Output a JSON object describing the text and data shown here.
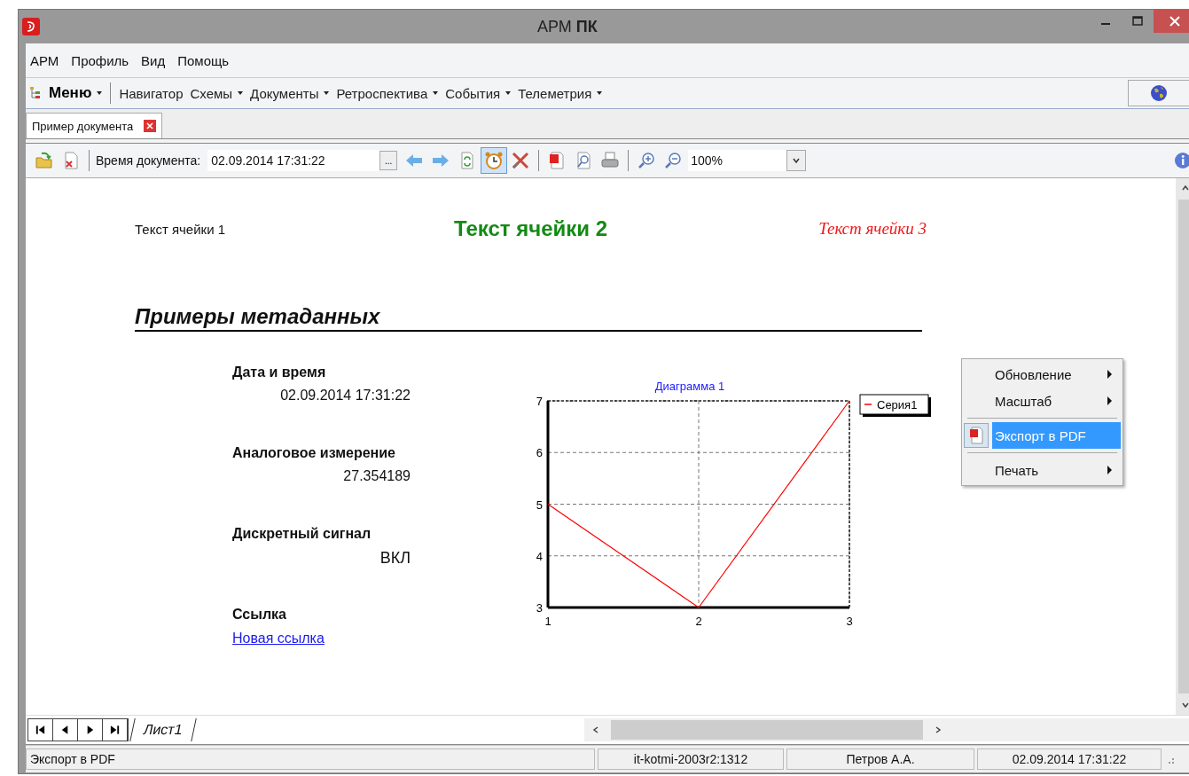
{
  "window": {
    "title": "АРМ **ПК**"
  },
  "menu_bar": [
    "АРМ",
    "Профиль",
    "Вид",
    "Помощь"
  ],
  "main_toolbar": {
    "menu_button": "Меню",
    "items": [
      {
        "label": "Навигатор",
        "has_dropdown": false
      },
      {
        "label": "Схемы",
        "has_dropdown": true
      },
      {
        "label": "Документы",
        "has_dropdown": true
      },
      {
        "label": "Ретроспектива",
        "has_dropdown": true
      },
      {
        "label": "События",
        "has_dropdown": true
      },
      {
        "label": "Телеметрия",
        "has_dropdown": true
      }
    ]
  },
  "tabs": [
    {
      "label": "Пример документа",
      "selected": true
    }
  ],
  "document_toolbar": {
    "time_label": "Время документа:",
    "time_value": "02.09.2014 17:31:22",
    "browse_button": "...",
    "clock_pressed": true,
    "zoom_value": "100%"
  },
  "document": {
    "cells": [
      {
        "text": "Текст ячейки 1",
        "kind": "plain"
      },
      {
        "text": "Текст ячейки 2",
        "kind": "green-bold"
      },
      {
        "text": "Текст ячейки 3",
        "kind": "red-italic"
      }
    ],
    "heading": "Примеры метаданных",
    "fields": [
      {
        "label": "Дата и время",
        "value": "02.09.2014 17:31:22",
        "kind": "text"
      },
      {
        "label": "Аналоговое измерение",
        "value": "27.354189",
        "kind": "text"
      },
      {
        "label": "Дискретный сигнал",
        "value": "ВКЛ",
        "kind": "large"
      },
      {
        "label": "Ссылка",
        "value": "Новая ссылка",
        "kind": "link"
      }
    ],
    "chart_data": {
      "type": "line",
      "title": "Диаграмма 1",
      "x": [
        1,
        2,
        3
      ],
      "xticks": [
        1,
        2,
        3
      ],
      "yticks": [
        3,
        4,
        5,
        6,
        7
      ],
      "ylim": [
        3,
        7
      ],
      "xlim": [
        1,
        3
      ],
      "grid": true,
      "series": [
        {
          "name": "Серия1",
          "color": "#ff0000",
          "values": [
            5,
            3,
            7
          ]
        }
      ]
    }
  },
  "context_menu": [
    {
      "kind": "item",
      "label": "Обновление",
      "has_submenu": true,
      "selected": false,
      "has_icon": false
    },
    {
      "kind": "item",
      "label": "Масштаб",
      "has_submenu": true,
      "selected": false,
      "has_icon": false
    },
    {
      "kind": "separator"
    },
    {
      "kind": "item",
      "label": "Экспорт в PDF",
      "has_submenu": false,
      "selected": true,
      "has_icon": true
    },
    {
      "kind": "separator"
    },
    {
      "kind": "item",
      "label": "Печать",
      "has_submenu": true,
      "selected": false,
      "has_icon": false
    }
  ],
  "sheet_tabs": [
    {
      "label": "Лист1",
      "selected": true
    }
  ],
  "status_bar": [
    "Экспорт в PDF",
    "it-kotmi-2003r2:1312",
    "Петров А.А.",
    "02.09.2014 17:31:22"
  ]
}
